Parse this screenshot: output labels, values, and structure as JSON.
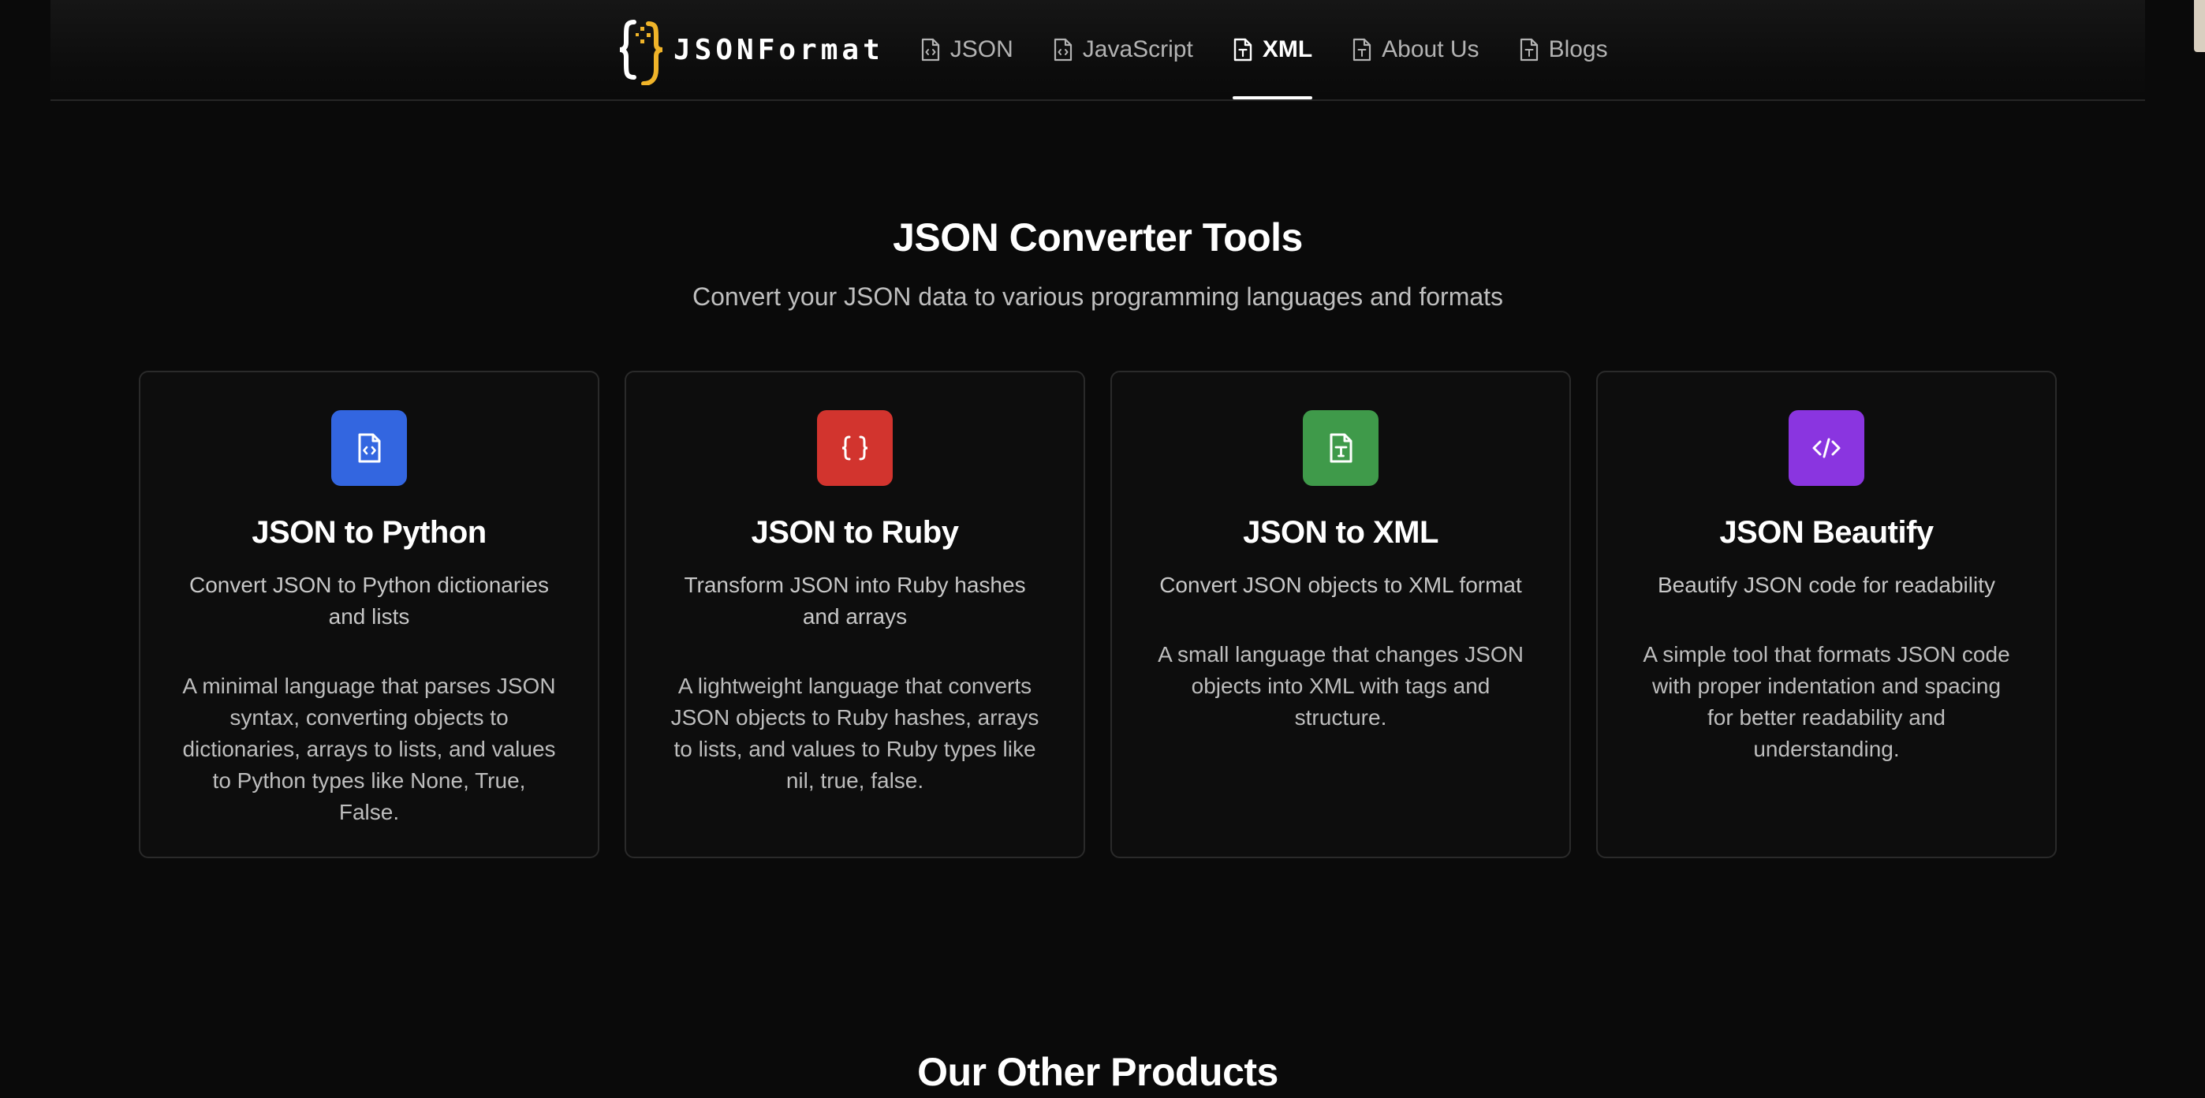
{
  "header": {
    "logo_text": "JSONFormat",
    "nav": [
      {
        "label": "JSON",
        "icon": "file-code-icon",
        "active": false
      },
      {
        "label": "JavaScript",
        "icon": "file-code-icon",
        "active": false
      },
      {
        "label": "XML",
        "icon": "file-text-icon",
        "active": true
      },
      {
        "label": "About Us",
        "icon": "file-text-icon",
        "active": false
      },
      {
        "label": "Blogs",
        "icon": "file-text-icon",
        "active": false
      }
    ]
  },
  "hero": {
    "title": "JSON Converter Tools",
    "subtitle": "Convert your JSON data to various programming languages and formats"
  },
  "cards": [
    {
      "title": "JSON to Python",
      "short": "Convert JSON to Python dictionaries and lists",
      "long": "A minimal language that parses JSON syntax, converting objects to dictionaries, arrays to lists, and values to Python types like None, True, False.",
      "icon": "file-code-icon",
      "color": "#3366e0"
    },
    {
      "title": "JSON to Ruby",
      "short": "Transform JSON into Ruby hashes and arrays",
      "long": "A lightweight language that converts JSON objects to Ruby hashes, arrays to lists, and values to Ruby types like nil, true, false.",
      "icon": "braces-icon",
      "color": "#d2342e"
    },
    {
      "title": "JSON to XML",
      "short": "Convert JSON objects to XML format",
      "long": "A small language that changes JSON objects into XML with tags and structure.",
      "icon": "file-type-icon",
      "color": "#3f9a4a"
    },
    {
      "title": "JSON Beautify",
      "short": "Beautify JSON code for readability",
      "long": "A simple tool that formats JSON code with proper indentation and spacing for better readability and understanding.",
      "icon": "code-icon",
      "color": "#8a35e0"
    }
  ],
  "other": {
    "title": "Our Other Products"
  }
}
